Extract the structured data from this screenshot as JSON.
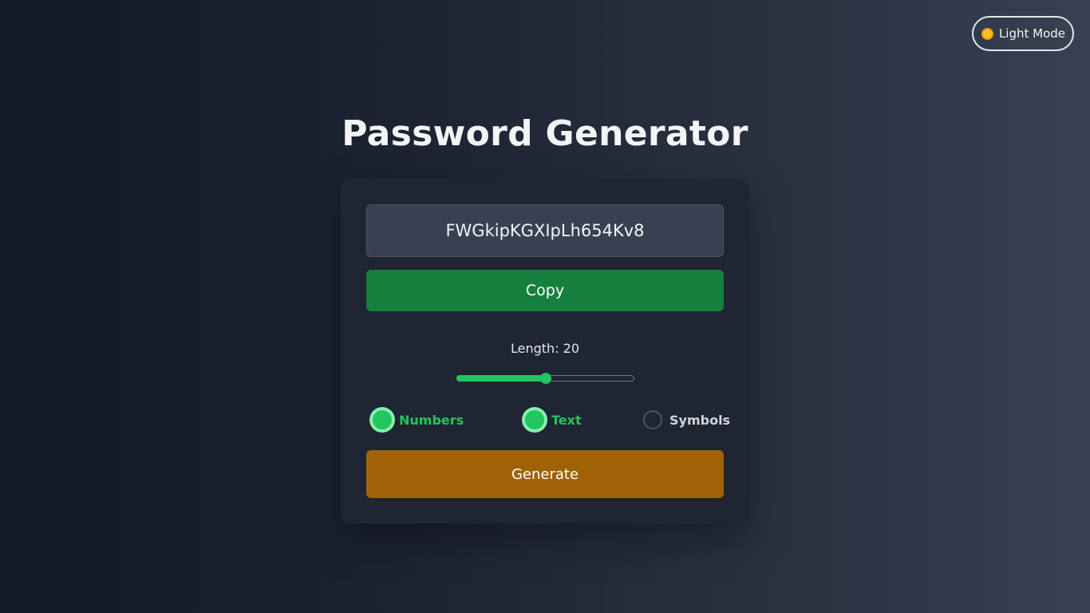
{
  "theme_toggle": {
    "icon": "sun-icon",
    "label": "Light Mode"
  },
  "title": "Password Generator",
  "password": {
    "value": "FWGkipKGXIpLh654Kv8"
  },
  "copy_button": {
    "label": "Copy"
  },
  "length": {
    "label": "Length: 20",
    "value": 20,
    "min": 4,
    "max": 36
  },
  "options": [
    {
      "label": "Numbers",
      "checked": true
    },
    {
      "label": "Text",
      "checked": true
    },
    {
      "label": "Symbols",
      "checked": false
    }
  ],
  "generate_button": {
    "label": "Generate"
  },
  "colors": {
    "accent_green": "#22c55e",
    "copy_button_bg": "#15803d",
    "generate_button_bg": "#a16207",
    "card_bg": "#1f2532",
    "input_bg": "#374151"
  }
}
